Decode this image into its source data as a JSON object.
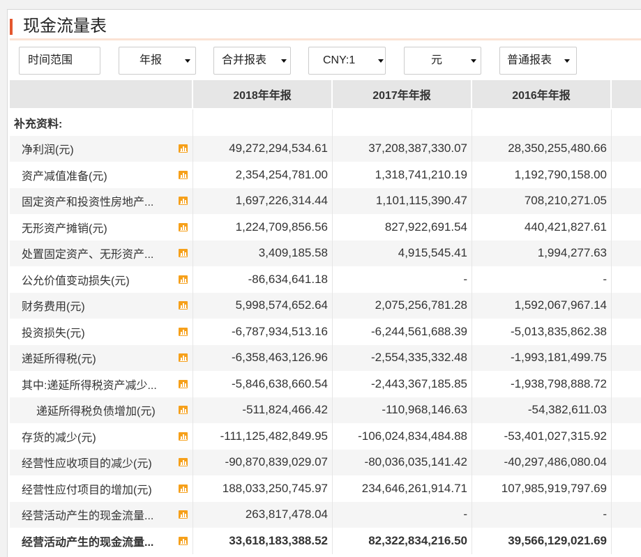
{
  "title": "现金流量表",
  "filters": {
    "time_range": "时间范围",
    "period": "年报",
    "consolidation": "合并报表",
    "currency": "CNY:1",
    "unit": "元",
    "report_type": "普通报表"
  },
  "table": {
    "headers": [
      "2018年年报",
      "2017年年报",
      "2016年年报"
    ],
    "rows": [
      {
        "label": "补充资料:"
      },
      {
        "label": "净利润(元)",
        "values": [
          "49,272,294,534.61",
          "37,208,387,330.07",
          "28,350,255,480.66"
        ]
      },
      {
        "label": "资产减值准备(元)",
        "values": [
          "2,354,254,781.00",
          "1,318,741,210.19",
          "1,192,790,158.00"
        ]
      },
      {
        "label": "固定资产和投资性房地产...",
        "values": [
          "1,697,226,314.44",
          "1,101,115,390.47",
          "708,210,271.05"
        ]
      },
      {
        "label": "无形资产摊销(元)",
        "values": [
          "1,224,709,856.56",
          "827,922,691.54",
          "440,421,827.61"
        ]
      },
      {
        "label": "处置固定资产、无形资产...",
        "values": [
          "3,409,185.58",
          "4,915,545.41",
          "1,994,277.63"
        ]
      },
      {
        "label": "公允价值变动损失(元)",
        "values": [
          "-86,634,641.18",
          "-",
          "-"
        ]
      },
      {
        "label": "财务费用(元)",
        "values": [
          "5,998,574,652.64",
          "2,075,256,781.28",
          "1,592,067,967.14"
        ]
      },
      {
        "label": "投资损失(元)",
        "values": [
          "-6,787,934,513.16",
          "-6,244,561,688.39",
          "-5,013,835,862.38"
        ]
      },
      {
        "label": "递延所得税(元)",
        "values": [
          "-6,358,463,126.96",
          "-2,554,335,332.48",
          "-1,993,181,499.75"
        ]
      },
      {
        "label": "其中:递延所得税资产减少...",
        "values": [
          "-5,846,638,660.54",
          "-2,443,367,185.85",
          "-1,938,798,888.72"
        ]
      },
      {
        "label": "递延所得税负债增加(元)",
        "values": [
          "-511,824,466.42",
          "-110,968,146.63",
          "-54,382,611.03"
        ]
      },
      {
        "label": "存货的减少(元)",
        "values": [
          "-111,125,482,849.95",
          "-106,024,834,484.88",
          "-53,401,027,315.92"
        ]
      },
      {
        "label": "经营性应收项目的减少(元)",
        "values": [
          "-90,870,839,029.07",
          "-80,036,035,141.42",
          "-40,297,486,080.04"
        ]
      },
      {
        "label": "经营性应付项目的增加(元)",
        "values": [
          "188,033,250,745.97",
          "234,646,261,914.71",
          "107,985,919,797.69"
        ]
      },
      {
        "label": "经营活动产生的现金流量...",
        "values": [
          "263,817,478.04",
          "-",
          "-"
        ]
      },
      {
        "label": "经营活动产生的现金流量...",
        "values": [
          "33,618,183,388.52",
          "82,322,834,216.50",
          "39,566,129,021.69"
        ]
      }
    ]
  },
  "icons": {
    "row_chart": "bar-chart-icon",
    "dropdown": "chevron-down-icon"
  },
  "colors": {
    "title_accent": "#e4572e",
    "title_rule": "#fbe3d4",
    "chart_icon": "#f6a01a",
    "header_bg": "#e6e6e6",
    "stripe_bg": "#f5f5f5"
  }
}
